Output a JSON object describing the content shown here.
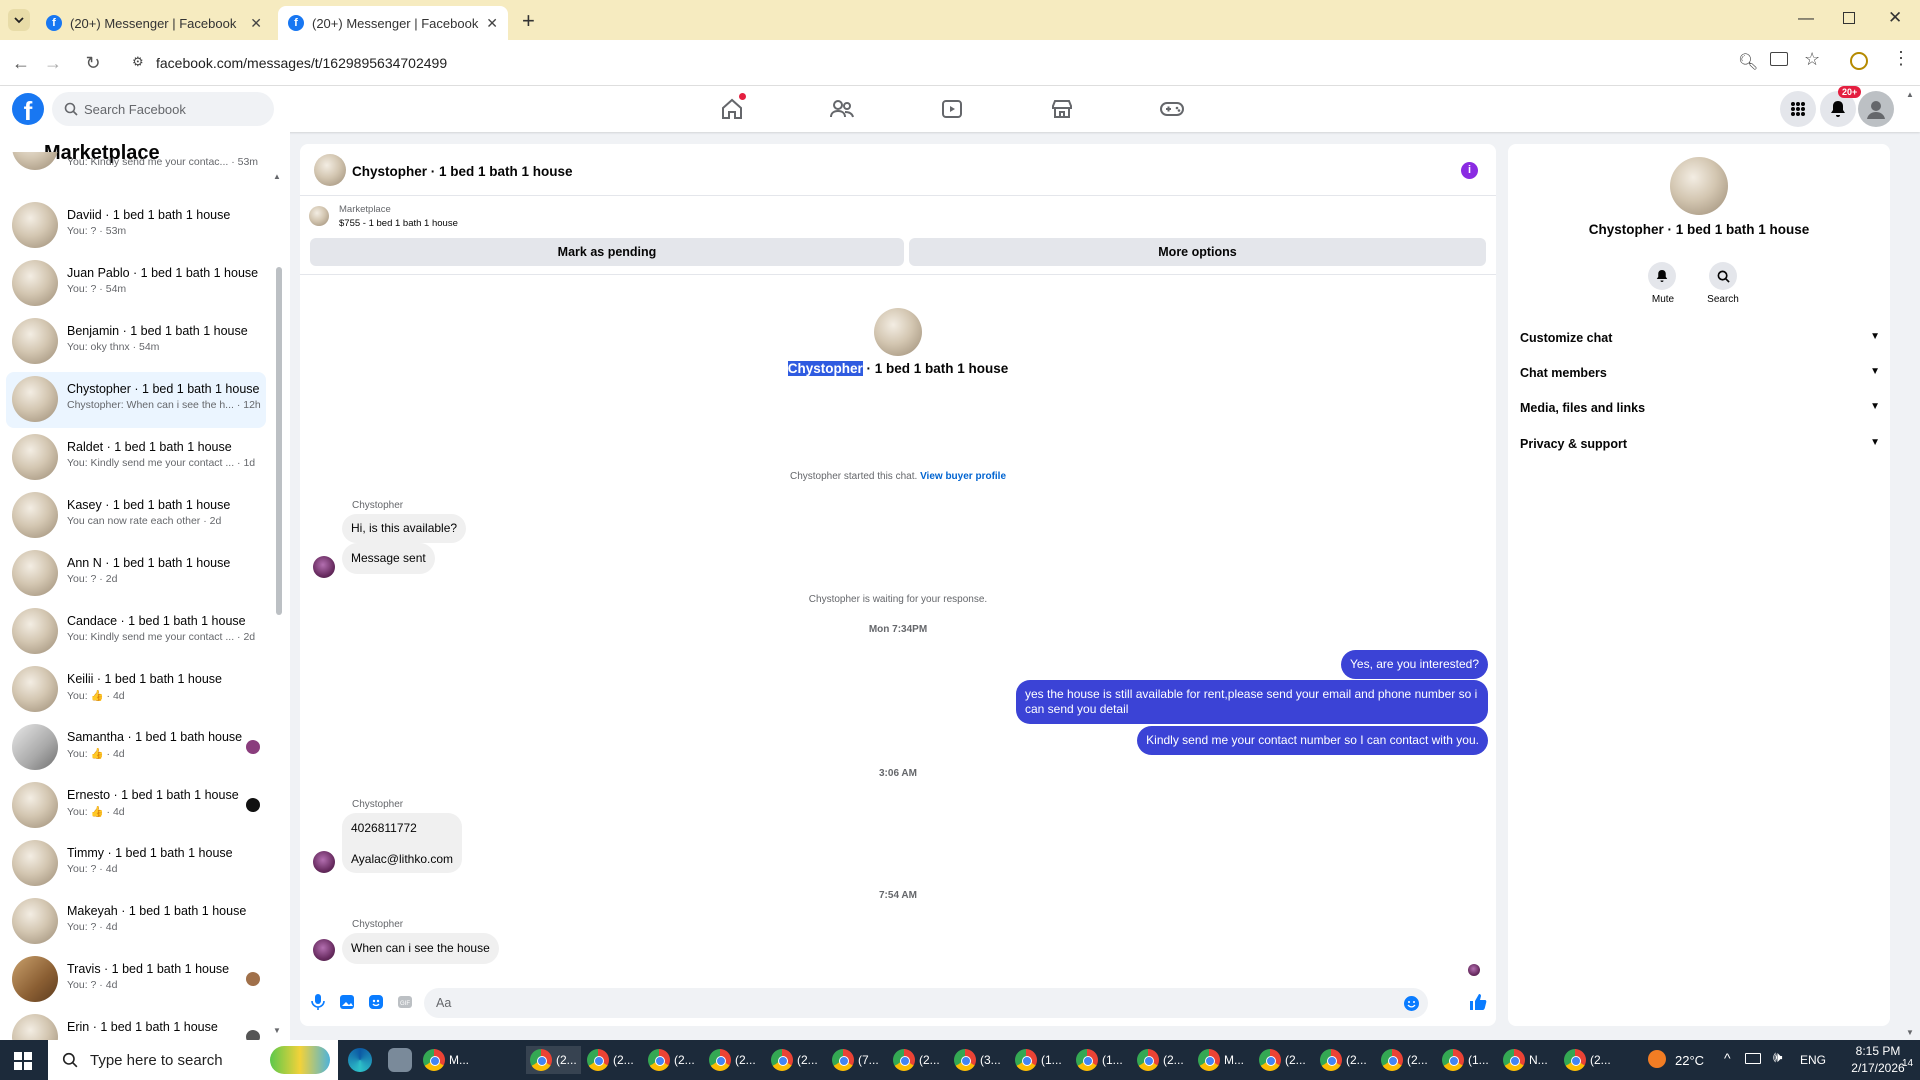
{
  "browser": {
    "tabs": [
      {
        "title": "(20+) Messenger | Facebook"
      },
      {
        "title": "(20+) Messenger | Facebook"
      }
    ],
    "url": "facebook.com/messages/t/1629895634702499"
  },
  "fb_header": {
    "search_placeholder": "Search Facebook",
    "notif_badge": "20+",
    "brand_color": "#1877f2"
  },
  "left": {
    "title": "Marketplace",
    "conversations": [
      {
        "name": "",
        "preview": "You: Kindly send me your contac... · 53m"
      },
      {
        "name": "Daviid · 1 bed 1 bath 1 house",
        "preview": "You: ? · 53m"
      },
      {
        "name": "Juan Pablo · 1 bed 1 bath 1 house",
        "preview": "You: ? · 54m"
      },
      {
        "name": "Benjamin · 1 bed 1 bath 1 house",
        "preview": "You: oky thnx · 54m"
      },
      {
        "name": "Chystopher · 1 bed 1 bath 1 house",
        "preview": "Chystopher: When can i see the h... · 12h"
      },
      {
        "name": "Raldet · 1 bed 1 bath 1 house",
        "preview": "You: Kindly send me your contact ... · 1d"
      },
      {
        "name": "Kasey · 1 bed 1 bath 1 house",
        "preview": "You can now rate each other · 2d"
      },
      {
        "name": "Ann N · 1 bed 1 bath 1 house",
        "preview": "You: ? · 2d"
      },
      {
        "name": "Candace · 1 bed 1 bath 1 house",
        "preview": "You: Kindly send me your contact ... · 2d"
      },
      {
        "name": "Keilii · 1 bed 1 bath 1 house",
        "preview": "You: 👍 · 4d"
      },
      {
        "name": "Samantha · 1 bed 1 bath house",
        "preview": "You: 👍 · 4d"
      },
      {
        "name": "Ernesto · 1 bed 1 bath 1 house",
        "preview": "You: 👍 · 4d"
      },
      {
        "name": "Timmy · 1 bed 1 bath 1 house",
        "preview": "You: ? · 4d"
      },
      {
        "name": "Makeyah · 1 bed 1 bath 1 house",
        "preview": "You: ? · 4d"
      },
      {
        "name": "Travis · 1 bed 1 bath 1 house",
        "preview": "You: ? · 4d"
      },
      {
        "name": "Erin · 1 bed 1 bath 1 house",
        "preview": ""
      }
    ]
  },
  "chat": {
    "header_title": "Chystopher · 1 bed 1 bath 1 house",
    "listing_source": "Marketplace",
    "listing_line": "$755 - 1 bed 1 bath 1 house",
    "mark_pending": "Mark as pending",
    "more_options": "More options",
    "intro_name_highlight": "Chystopher",
    "intro_name_rest": " · 1 bed 1 bath 1 house",
    "started_text": "Chystopher started this chat.",
    "view_profile": "View buyer profile",
    "sender_name": "Chystopher",
    "msg1": "Hi, is this available?",
    "msg2": "Message sent",
    "waiting": "Chystopher is waiting for your response.",
    "time1": "Mon 7:34PM",
    "out1": "Yes, are you interested?",
    "out2": "yes the house is still available for rent,please send your email and phone number so i can send you detail",
    "out3": "Kindly send me your contact number so I can contact with you.",
    "time2": "3:06 AM",
    "msg3": "4026811772",
    "msg4": "Ayalac@lithko.com",
    "time3": "7:54 AM",
    "msg5": "When can i see the house",
    "composer_placeholder": "Aa",
    "out_color": "#3b43d6"
  },
  "right": {
    "title": "Chystopher · 1 bed 1 bath 1 house",
    "mute": "Mute",
    "search": "Search",
    "sections": [
      "Customize chat",
      "Chat members",
      "Media, files and links",
      "Privacy & support"
    ]
  },
  "taskbar": {
    "search_placeholder": "Type here to search",
    "items": [
      "M...",
      "(2...",
      "(2...",
      "(2...",
      "(2...",
      "(2...",
      "(7...",
      "(2...",
      "(3...",
      "(1...",
      "(1...",
      "(2...",
      "M...",
      "(2...",
      "(2...",
      "(2...",
      "(1...",
      "N...",
      "(2..."
    ],
    "temp": "22°C",
    "lang": "ENG",
    "time": "8:15 PM",
    "date": "2/17/2026",
    "notif_count": "14"
  }
}
